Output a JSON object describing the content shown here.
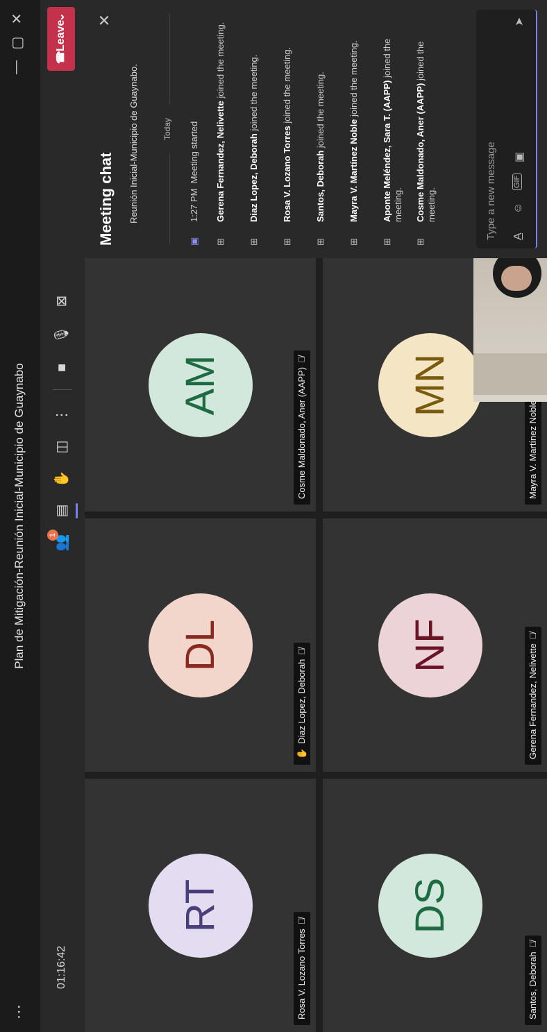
{
  "window": {
    "title": "Plan de Mitigación-Reunión Inicial-Municipio de Guaynabo",
    "menu_icon": "ellipsis-icon",
    "minimize": "—",
    "restore": "▢",
    "close": "✕"
  },
  "controls": {
    "timer": "01:16:42",
    "participants_badge": "1",
    "leave_label": "Leave",
    "more": "⋮"
  },
  "tiles": [
    {
      "initials": "RT",
      "name": "Rosa V. Lozano Torres",
      "bg": "#e4ddf1",
      "fg": "#4b3f7a"
    },
    {
      "initials": "DL",
      "name": "Diaz Lopez, Deborah",
      "bg": "#f2d6cc",
      "fg": "#8a2a1e",
      "hand": true
    },
    {
      "initials": "AM",
      "name": "Cosme Maldonado, Aner (AAPP)",
      "bg": "#d3e8dc",
      "fg": "#1e6b43"
    },
    {
      "initials": "DS",
      "name": "Santos, Deborah",
      "bg": "#d3e8dc",
      "fg": "#1e6b43"
    },
    {
      "initials": "NF",
      "name": "Gerena Fernandez, Nelivette",
      "bg": "#ebd3d7",
      "fg": "#6b1426"
    },
    {
      "initials": "MN",
      "name": "Mayra V. Martínez Noble",
      "bg": "#f4e6c4",
      "fg": "#7a5b0e"
    }
  ],
  "chat": {
    "title": "Meeting chat",
    "cut_text": "Reunión Inicial-Municipio de Guaynabo.",
    "today": "Today",
    "events": [
      {
        "time": "1:27 PM",
        "name": "",
        "text": "Meeting started"
      },
      {
        "name": "Gerena Fernandez, Nelivette",
        "text": " joined the meeting."
      },
      {
        "name": "Diaz Lopez, Deborah",
        "text": " joined the meeting."
      },
      {
        "name": "Rosa V. Lozano Torres",
        "text": " joined the meeting."
      },
      {
        "name": "Santos, Deborah",
        "text": " joined the meeting."
      },
      {
        "name": "Mayra V. Martínez Noble",
        "text": " joined the meeting."
      },
      {
        "name": "Aponte Meléndez, Sara T. (AAPP)",
        "text": " joined the meeting."
      },
      {
        "name": "Cosme Maldonado, Aner (AAPP)",
        "text": " joined the meeting."
      }
    ],
    "placeholder": "Type a new message"
  }
}
